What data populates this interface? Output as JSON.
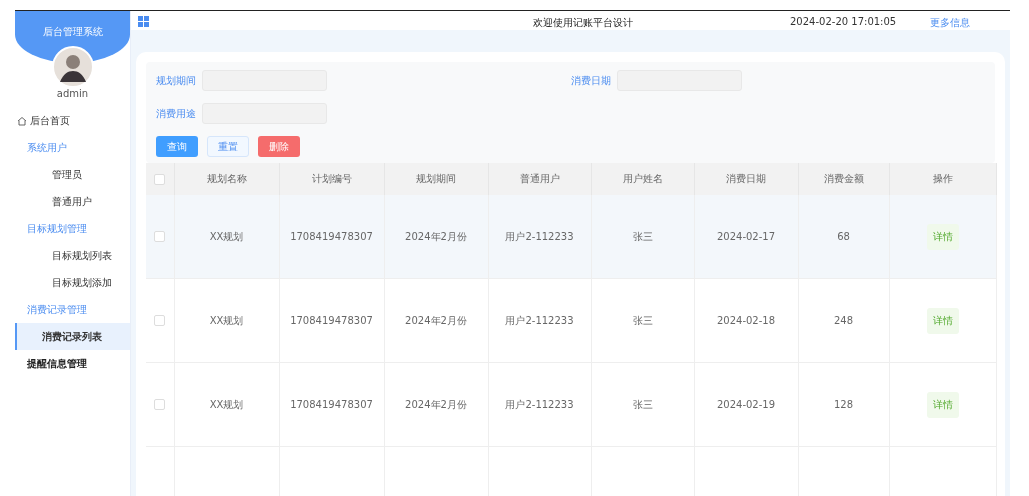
{
  "sidebar": {
    "title": "后台管理系统",
    "user": "admin",
    "items": [
      {
        "kind": "home",
        "label": "后台首页"
      },
      {
        "kind": "group",
        "label": "系统用户",
        "expanded": true,
        "children": [
          {
            "label": "管理员",
            "selected": false
          },
          {
            "label": "普通用户",
            "selected": false
          }
        ]
      },
      {
        "kind": "group",
        "label": "目标规划管理",
        "expanded": true,
        "children": [
          {
            "label": "目标规划列表",
            "selected": false
          },
          {
            "label": "目标规划添加",
            "selected": false
          }
        ]
      },
      {
        "kind": "group",
        "label": "消费记录管理",
        "expanded": true,
        "children": [
          {
            "label": "消费记录列表",
            "selected": true
          }
        ]
      },
      {
        "kind": "group",
        "label": "提醒信息管理",
        "expanded": false
      }
    ]
  },
  "header": {
    "title": "欢迎使用记账平台设计",
    "datetime": "2024-02-20 17:01:05",
    "link": "更多信息"
  },
  "search": {
    "fields": [
      {
        "label": "规划期间"
      },
      {
        "label": "消费日期"
      },
      {
        "label": "消费用途"
      }
    ],
    "buttons": [
      {
        "kind": "primary",
        "label": "查询"
      },
      {
        "kind": "plain",
        "label": "重置"
      },
      {
        "kind": "danger",
        "label": "删除"
      }
    ]
  },
  "table": {
    "select_all": {
      "checked": false
    },
    "columns": [
      "规划名称",
      "计划编号",
      "规划期间",
      "普通用户",
      "用户姓名",
      "消费日期",
      "消费金额",
      "操作"
    ],
    "rows": [
      {
        "checked": false,
        "highlighted": true,
        "cells": [
          "XX规划",
          "1708419478307",
          "2024年2月份",
          "用户2-112233",
          "张三",
          "2024-02-17",
          "68"
        ],
        "action": "详情"
      },
      {
        "checked": false,
        "highlighted": false,
        "cells": [
          "XX规划",
          "1708419478307",
          "2024年2月份",
          "用户2-112233",
          "张三",
          "2024-02-18",
          "248"
        ],
        "action": "详情"
      },
      {
        "checked": false,
        "highlighted": false,
        "cells": [
          "XX规划",
          "1708419478307",
          "2024年2月份",
          "用户2-112233",
          "张三",
          "2024-02-19",
          "128"
        ],
        "action": "详情"
      }
    ]
  }
}
